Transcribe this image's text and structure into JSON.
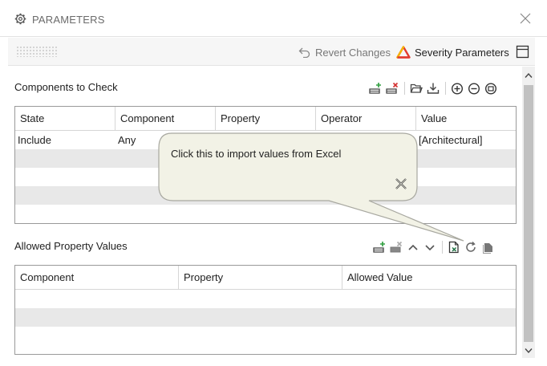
{
  "window": {
    "title": "PARAMETERS",
    "gear_icon": "gear-icon",
    "close_icon": "close-icon"
  },
  "toolbar": {
    "grip_icon": "drag-grip-icon",
    "revert_label": "Revert Changes",
    "severity_label": "Severity Parameters",
    "panel_icon": "panel-toggle-icon"
  },
  "components_section": {
    "title": "Components to Check",
    "icons": [
      "add-row-icon",
      "delete-row-icon",
      "open-folder-icon",
      "download-icon",
      "add-circle-icon",
      "remove-circle-icon",
      "clear-icon"
    ],
    "columns": [
      "State",
      "Component",
      "Property",
      "Operator",
      "Value"
    ],
    "rows": [
      [
        "Include",
        "Any",
        "",
        "",
        "[Architectural]"
      ]
    ]
  },
  "allowed_section": {
    "title": "Allowed Property Values",
    "icons": [
      "add-row-icon",
      "delete-row-icon",
      "chevron-up-icon",
      "chevron-down-icon",
      "excel-import-icon",
      "refresh-icon",
      "clear-icon"
    ],
    "columns": [
      "Component",
      "Property",
      "Allowed Value"
    ],
    "rows": []
  },
  "tooltip": {
    "text": "Click this to import values from Excel",
    "close_icon": "close-icon"
  },
  "colors": {
    "accent_red": "#e23b2e",
    "accent_yellow": "#f5b400",
    "excel_green": "#217346",
    "row_alt": "#e8e8e8"
  }
}
